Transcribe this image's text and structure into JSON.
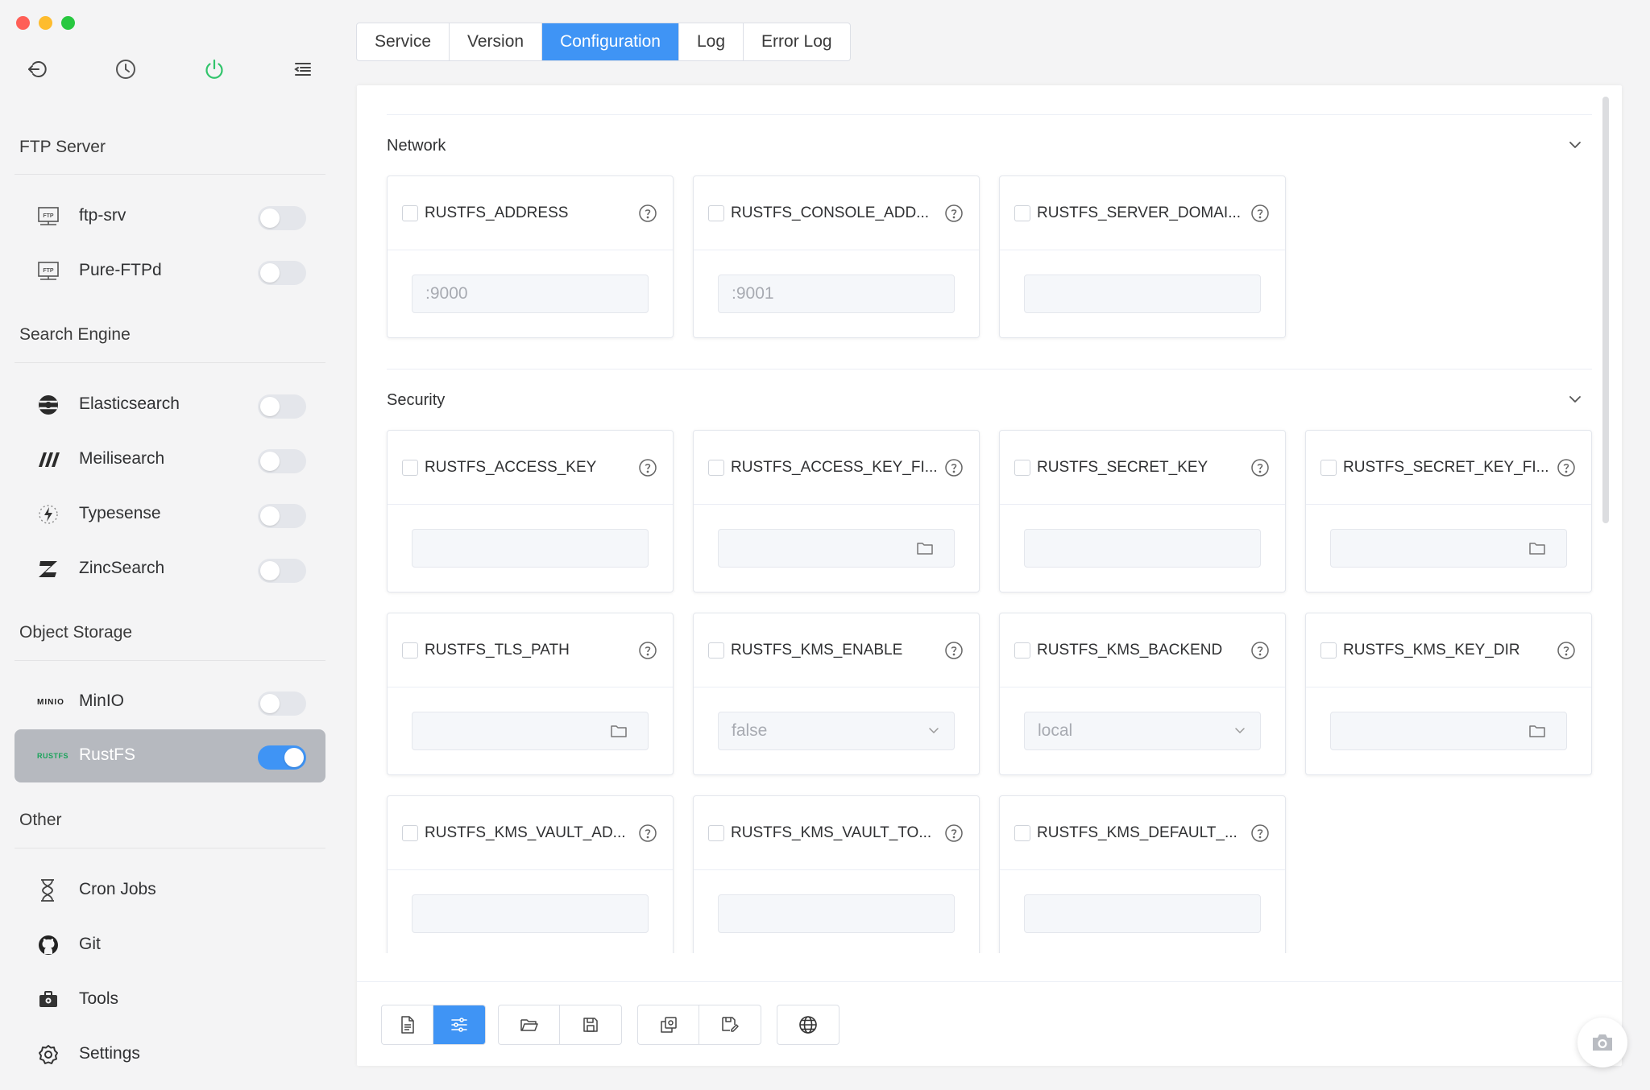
{
  "sidebar": {
    "sections": [
      {
        "title": "FTP Server",
        "items": [
          {
            "label": "ftp-srv",
            "icon": "ftp-icon",
            "enabled": false
          },
          {
            "label": "Pure-FTPd",
            "icon": "ftp-icon",
            "enabled": false
          }
        ]
      },
      {
        "title": "Search Engine",
        "items": [
          {
            "label": "Elasticsearch",
            "icon": "elasticsearch-icon",
            "enabled": false
          },
          {
            "label": "Meilisearch",
            "icon": "meilisearch-icon",
            "enabled": false
          },
          {
            "label": "Typesense",
            "icon": "typesense-icon",
            "enabled": false
          },
          {
            "label": "ZincSearch",
            "icon": "zincsearch-icon",
            "enabled": false
          }
        ]
      },
      {
        "title": "Object Storage",
        "items": [
          {
            "label": "MinIO",
            "icon": "minio-icon",
            "logo_text": "MINIO",
            "enabled": false
          },
          {
            "label": "RustFS",
            "icon": "rustfs-icon",
            "logo_text": "RUSTFS",
            "enabled": true,
            "active": true
          }
        ]
      },
      {
        "title": "Other",
        "items": [
          {
            "label": "Cron Jobs",
            "icon": "hourglass-icon"
          },
          {
            "label": "Git",
            "icon": "github-icon"
          },
          {
            "label": "Tools",
            "icon": "toolbox-icon"
          },
          {
            "label": "Settings",
            "icon": "gear-icon"
          }
        ]
      }
    ],
    "ftp_logo_text": "FTP"
  },
  "tabs": [
    {
      "label": "Service",
      "active": false
    },
    {
      "label": "Version",
      "active": false
    },
    {
      "label": "Configuration",
      "active": true
    },
    {
      "label": "Log",
      "active": false
    },
    {
      "label": "Error Log",
      "active": false
    }
  ],
  "groups": {
    "network": {
      "title": "Network",
      "cards": [
        {
          "name": "RUSTFS_ADDRESS",
          "placeholder": ":9000"
        },
        {
          "name": "RUSTFS_CONSOLE_ADD...",
          "placeholder": ":9001"
        },
        {
          "name": "RUSTFS_SERVER_DOMAI...",
          "placeholder": ""
        }
      ]
    },
    "security": {
      "title": "Security",
      "cards": [
        {
          "name": "RUSTFS_ACCESS_KEY",
          "placeholder": ""
        },
        {
          "name": "RUSTFS_ACCESS_KEY_FI...",
          "placeholder": ""
        },
        {
          "name": "RUSTFS_SECRET_KEY",
          "placeholder": ""
        },
        {
          "name": "RUSTFS_SECRET_KEY_FI...",
          "placeholder": ""
        },
        {
          "name": "RUSTFS_TLS_PATH",
          "placeholder": ""
        },
        {
          "name": "RUSTFS_KMS_ENABLE",
          "value": "false"
        },
        {
          "name": "RUSTFS_KMS_BACKEND",
          "value": "local"
        },
        {
          "name": "RUSTFS_KMS_KEY_DIR",
          "placeholder": ""
        },
        {
          "name": "RUSTFS_KMS_VAULT_AD...",
          "placeholder": ""
        },
        {
          "name": "RUSTFS_KMS_VAULT_TO...",
          "placeholder": ""
        },
        {
          "name": "RUSTFS_KMS_DEFAULT_...",
          "placeholder": ""
        }
      ]
    }
  },
  "toolbar": {
    "buttons": [
      "document-icon",
      "sliders-icon",
      "folder-open-icon",
      "save-icon",
      "copy-icon",
      "save-as-icon",
      "globe-icon"
    ],
    "active": "sliders-icon"
  },
  "colors": {
    "accent": "#3f94f5",
    "sidebar_bg": "#f4f4f5",
    "active_item_bg": "#b6b9bf",
    "power_green": "#31c46b"
  }
}
